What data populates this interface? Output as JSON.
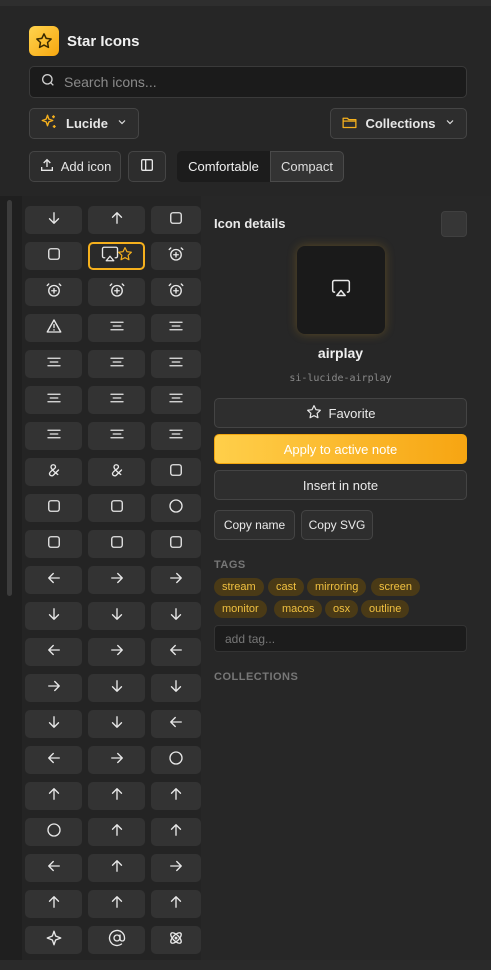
{
  "app": {
    "title": "Star Icons"
  },
  "search": {
    "placeholder": "Search icons..."
  },
  "toolbar": {
    "library_label": "Lucide",
    "collections_label": "Collections",
    "add_icon_label": "Add icon",
    "density_comfortable": "Comfortable",
    "density_compact": "Compact"
  },
  "details": {
    "title": "Icon details",
    "icon_name": "airplay",
    "icon_id": "si-lucide-airplay",
    "favorite_label": "Favorite",
    "apply_label": "Apply to active note",
    "insert_label": "Insert in note",
    "copy_name_label": "Copy name",
    "copy_svg_label": "Copy SVG",
    "tags_heading": "TAGS",
    "tags": [
      "stream",
      "cast",
      "mirroring",
      "screen",
      "monitor",
      "macos",
      "osx",
      "outline"
    ],
    "add_tag_placeholder": "add tag...",
    "collections_heading": "COLLECTIONS"
  },
  "colors": {
    "accent": "#f5b01d",
    "accent_light": "#ffcf4a",
    "bg": "#262626",
    "tag_bg": "#4a3a16",
    "tag_text": "#f0c040"
  },
  "grid_icons": [
    "arrow-down-a-icon",
    "arrow-up-a-icon",
    "case-sensitive-icon",
    "air-vent-icon",
    "airplay-icon",
    "alarm-check-icon",
    "alarm-plus-icon",
    "alarm-minus-icon",
    "alarm-clock-plus-icon",
    "alert-triangle-icon",
    "align-center-icon",
    "align-center-horizontal-icon",
    "align-vertical-space-around-icon",
    "align-end-vertical-icon",
    "align-horizontal-justify-center-icon",
    "align-justify-icon",
    "align-left-icon",
    "align-right-icon",
    "align-vertical-justify-start-icon",
    "align-vertical-justify-center-icon",
    "align-vertical-justify-end-icon",
    "ampersand-icon",
    "ampersands-icon",
    "amphora-icon",
    "anvil-icon",
    "anvil-icon",
    "aperture-icon",
    "archive-restore-icon",
    "archive-x-icon",
    "area-chart-icon",
    "arrow-big-left-icon",
    "arrow-big-right-icon",
    "arrow-big-right-dash-icon",
    "arrow-down-0-1-icon",
    "arrow-down-1-0-icon",
    "arrow-down-1-0-icon",
    "arrow-down-left-icon",
    "arrow-down-right-icon",
    "arrow-down-left-square-icon",
    "arrow-down-right-square-icon",
    "arrow-down-square-icon",
    "arrow-down-to-line-icon",
    "arrow-down-z-a-icon",
    "arrow-down-z-a-icon",
    "arrow-left-icon",
    "arrow-left-to-line-icon",
    "arrow-right-icon",
    "arrow-right-circle-icon",
    "arrow-up-icon",
    "arrow-up-0-1-icon",
    "arrow-up-1-0-icon",
    "arrow-up-circle-icon",
    "arrow-up-down-icon",
    "arrow-up-narrow-icon",
    "arrow-up-left-square-icon",
    "arrow-up-wide-narrow-icon",
    "arrow-up-right-icon",
    "arrow-up-to-line-icon",
    "arrow-up-narrow-wide-icon",
    "arrow-up-z-a-icon",
    "sparkle-icon",
    "at-sign-icon",
    "atom-icon"
  ]
}
